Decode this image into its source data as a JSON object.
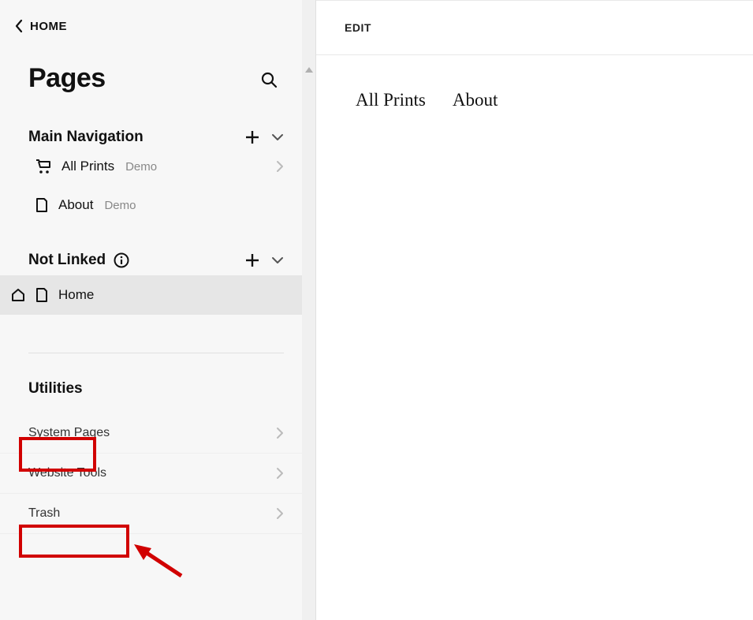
{
  "back": {
    "label": "HOME"
  },
  "title": "Pages",
  "sections": {
    "main_nav": {
      "label": "Main Navigation",
      "items": [
        {
          "label": "All Prints",
          "demo": "Demo"
        },
        {
          "label": "About",
          "demo": "Demo"
        }
      ]
    },
    "not_linked": {
      "label": "Not Linked",
      "items": [
        {
          "label": "Home"
        }
      ]
    },
    "utilities": {
      "label": "Utilities",
      "items": [
        {
          "label": "System Pages"
        },
        {
          "label": "Website Tools"
        },
        {
          "label": "Trash"
        }
      ]
    }
  },
  "topbar": {
    "edit": "EDIT"
  },
  "preview_nav": {
    "items": [
      {
        "label": "All Prints"
      },
      {
        "label": "About"
      }
    ]
  }
}
